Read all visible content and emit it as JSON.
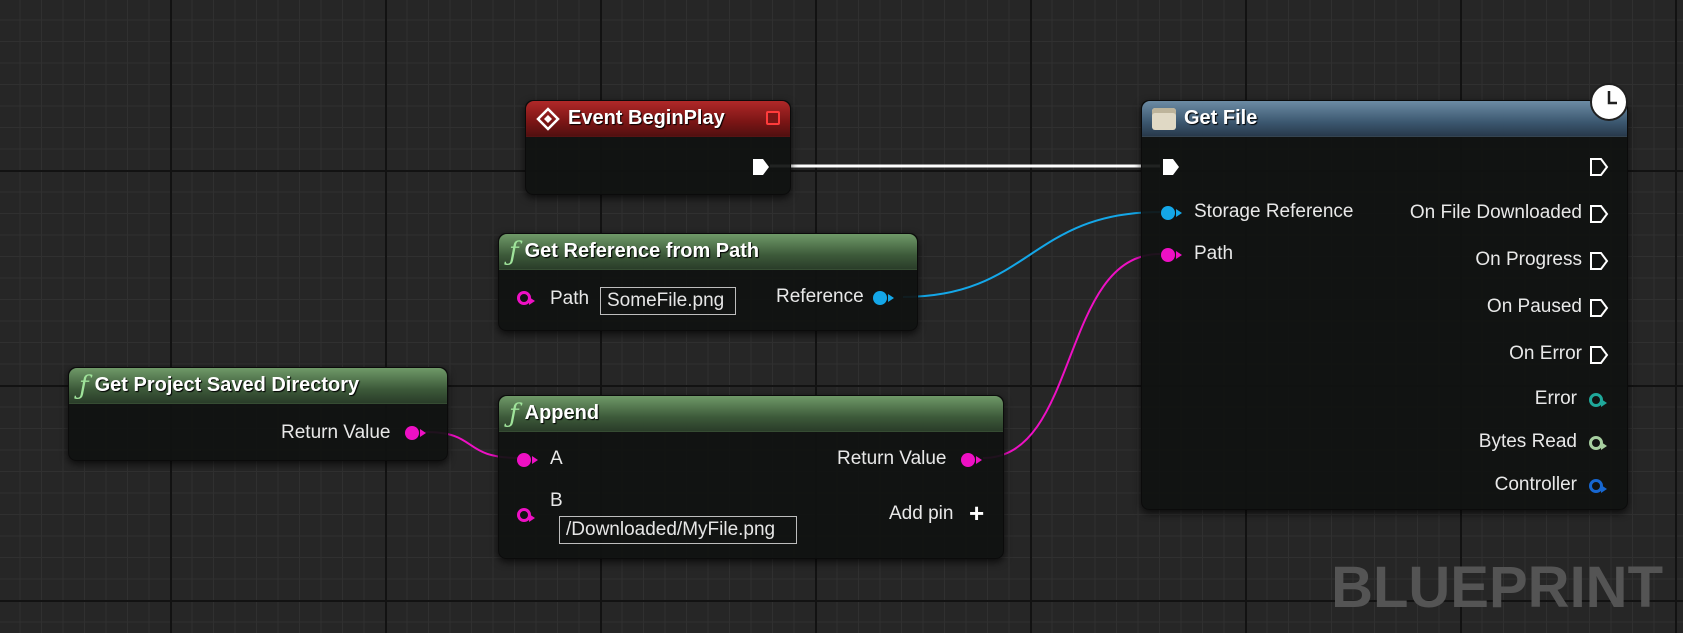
{
  "watermark": "BLUEPRINT",
  "colors": {
    "exec_wire": "#ffffff",
    "object_pin": "#14a7e8",
    "string_pin": "#ee10c4",
    "integer_pin": "#1fa89a",
    "int64_pin": "#a7cfa0",
    "controller_pin": "#1767d1",
    "function_header": "#4c7348",
    "event_header": "#8a1818",
    "async_header": "#4a6a84"
  },
  "nodes": {
    "event_begin_play": {
      "title": "Event BeginPlay",
      "icon": "event-diamond-icon"
    },
    "get_reference": {
      "title": "Get Reference from Path",
      "icon": "function-icon",
      "path_label": "Path",
      "path_value": "SomeFile.png",
      "output_label": "Reference"
    },
    "get_project_saved_dir": {
      "title": "Get Project Saved Directory",
      "icon": "function-icon",
      "output_label": "Return Value"
    },
    "append": {
      "title": "Append",
      "icon": "function-icon",
      "input_a_label": "A",
      "input_b_label": "B",
      "input_b_value": "/Downloaded/MyFile.png",
      "output_label": "Return Value",
      "add_pin_label": "Add pin"
    },
    "get_file": {
      "title": "Get File",
      "icon": "async-task-icon",
      "latent_icon": "clock-icon",
      "inputs": [
        "Storage Reference",
        "Path"
      ],
      "outputs": [
        "On File Downloaded",
        "On Progress",
        "On Paused",
        "On Error",
        "Error",
        "Bytes Read",
        "Controller"
      ]
    }
  }
}
